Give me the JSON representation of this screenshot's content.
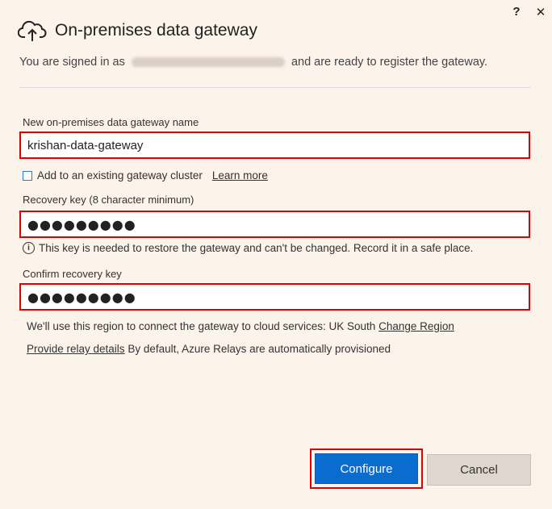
{
  "titlebar": {
    "help_label": "?",
    "close_label": "✕"
  },
  "header": {
    "icon": "cloud-upload-icon",
    "title": "On-premises data gateway"
  },
  "signed_in": {
    "prefix": "You are signed in as",
    "suffix": "and are ready to register the gateway."
  },
  "gateway_name": {
    "label": "New on-premises data gateway name",
    "value": "krishan-data-gateway"
  },
  "cluster": {
    "label": "Add to an existing gateway cluster",
    "checked": false,
    "learn_more": "Learn more"
  },
  "recovery": {
    "label": "Recovery key (8 character minimum)",
    "value": "●●●●●●●●●"
  },
  "recovery_info": "This key is needed to restore the gateway and can't be changed. Record it in a safe place.",
  "confirm": {
    "label": "Confirm recovery key",
    "value": "●●●●●●●●●"
  },
  "region": {
    "text": "We'll use this region to connect the gateway to cloud services: UK South",
    "link": "Change Region"
  },
  "relay": {
    "link": "Provide relay details",
    "text": "By default, Azure Relays are automatically provisioned"
  },
  "buttons": {
    "configure": "Configure",
    "cancel": "Cancel"
  },
  "colors": {
    "accent": "#0a6ccf",
    "highlight": "#e00000",
    "background": "#fcf3ea"
  }
}
